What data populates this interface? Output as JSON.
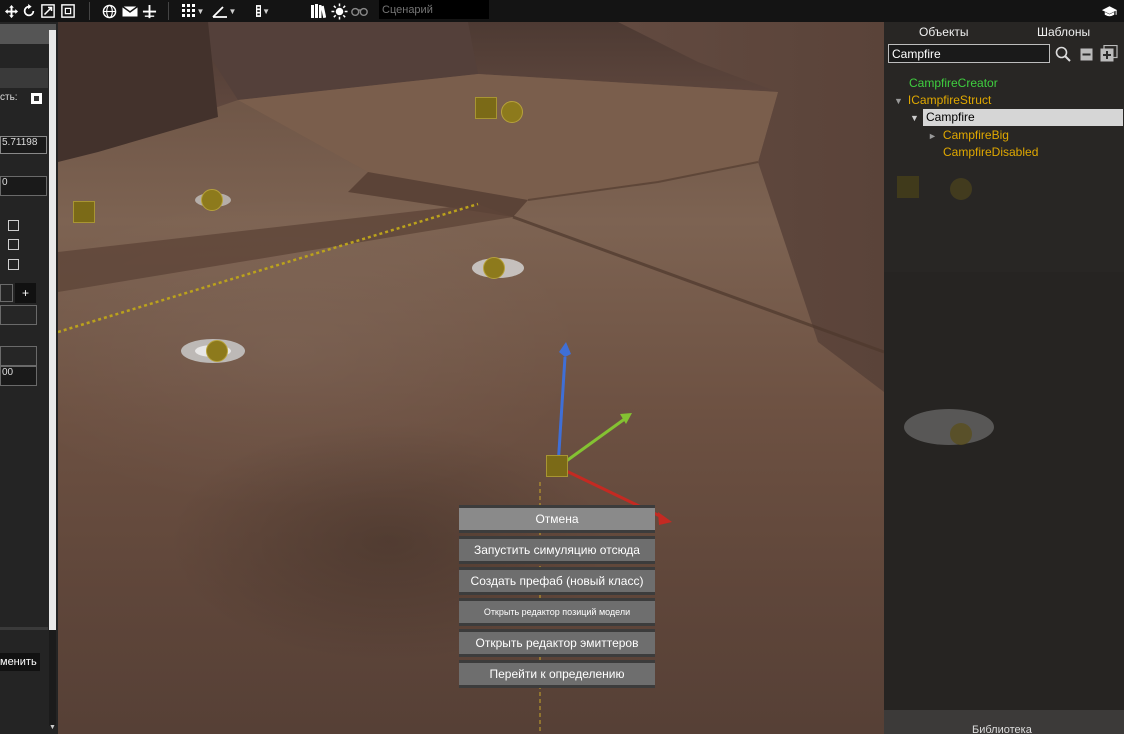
{
  "toolbar": {
    "scenario_placeholder": "Сценарий",
    "icons": [
      "move-icon",
      "rotate-icon",
      "scale-icon",
      "select-box-icon",
      "globe-icon",
      "envelope-icon",
      "snap-plus-icon",
      "grid-icon",
      "angle-icon",
      "vertical-dots-icon",
      "books-icon",
      "sun-icon",
      "binoculars-icon",
      "graduation-cap-icon"
    ]
  },
  "left_panel": {
    "label_suffix": "сть:",
    "field_value": "5.71198",
    "field2_value": "0",
    "plus_label": "+",
    "field3_value": "00",
    "apply_label": "менить"
  },
  "right_panel": {
    "tab_objects": "Объекты",
    "tab_templates": "Шаблоны",
    "search_value": "Campfire",
    "tree": [
      {
        "label": "CampfireCreator",
        "color": "#3fcf3f",
        "arrow": ""
      },
      {
        "label": "ICampfireStruct",
        "color": "#e0a800",
        "arrow": "▼"
      },
      {
        "label": "Campfire",
        "color": "#000000",
        "arrow": "▼",
        "selected": true
      },
      {
        "label": "CampfireBig",
        "color": "#e0a800",
        "arrow": "►"
      },
      {
        "label": "CampfireDisabled",
        "color": "#e0a800",
        "arrow": ""
      }
    ],
    "bottom_label": "Библиотека"
  },
  "context_menu": {
    "items": [
      "Отмена",
      "Запустить симуляцию отсюда",
      "Создать префаб (новый класс)",
      "Открыть редактор позиций модели",
      "Открыть редактор эмиттеров",
      "Перейти к определению"
    ]
  }
}
